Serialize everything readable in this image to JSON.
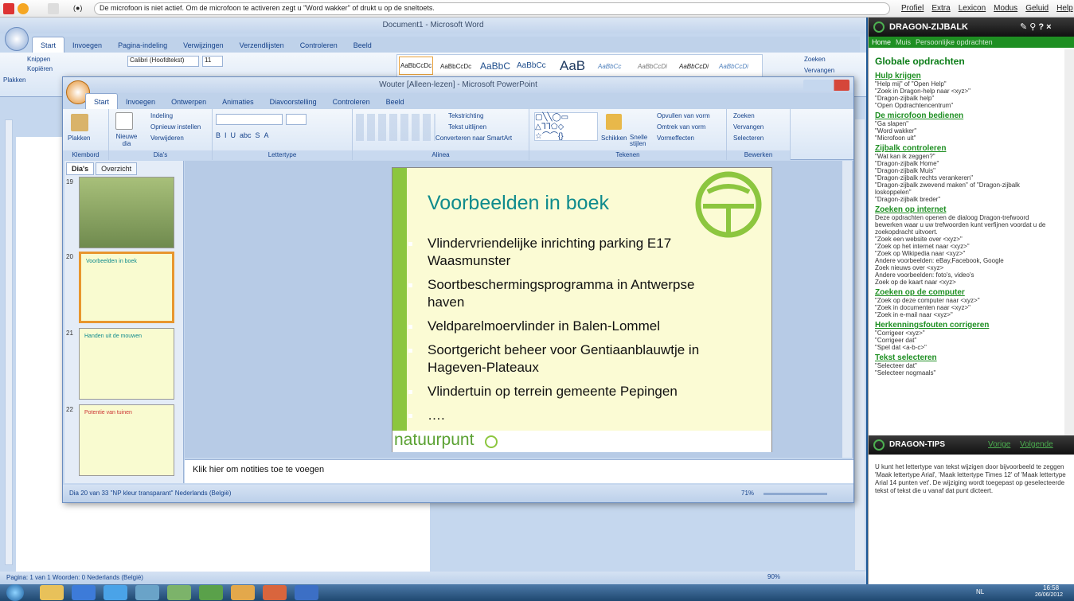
{
  "dragonbar": {
    "message": "De microfoon is niet actief. Om de microfoon te activeren zegt u \"Word wakker\" of drukt u op de sneltoets.",
    "menu": [
      "Profiel",
      "Extra",
      "Lexicon",
      "Modus",
      "Geluid",
      "Help"
    ]
  },
  "word": {
    "title": "Document1 - Microsoft Word",
    "tabs": [
      "Start",
      "Invoegen",
      "Pagina-indeling",
      "Verwijzingen",
      "Verzendlijsten",
      "Controleren",
      "Beeld"
    ],
    "font_name": "Calibri (Hoofdtekst)",
    "font_size": "11",
    "styles": [
      "AaBbCcDc",
      "AaBbCcDc",
      "AaBbC",
      "AaBbCc",
      "AaB",
      "AaBbCc",
      "AaBbCcDi",
      "AaBbCcDi",
      "AaBbCcDi"
    ],
    "clipboard": [
      "Knippen",
      "Kopiëren",
      "Plakken"
    ],
    "find": "Zoeken",
    "replace": "Vervangen",
    "status": "Pagina: 1 van 1   Woorden: 0   Nederlands (België)",
    "zoom": "90%"
  },
  "ppt": {
    "title": "Wouter [Alleen-lezen] - Microsoft PowerPoint",
    "tabs": [
      "Start",
      "Invoegen",
      "Ontwerpen",
      "Animaties",
      "Diavoorstelling",
      "Controleren",
      "Beeld"
    ],
    "ribbon": {
      "plakken": "Plakken",
      "klembord": "Klembord",
      "nieuwe_dia": "Nieuwe dia",
      "indeling": "Indeling",
      "opnieuw": "Opnieuw instellen",
      "verwijderen": "Verwijderen",
      "dias": "Dia's",
      "lettertype": "Lettertype",
      "alinea": "Alinea",
      "tekstrichting": "Tekstrichting",
      "tekst_uitlijnen": "Tekst uitlijnen",
      "smartart": "Converteren naar SmartArt",
      "tekenen": "Tekenen",
      "schikken": "Schikken",
      "snelle_stijlen": "Snelle stijlen",
      "opvullen": "Opvullen van vorm",
      "omtrek": "Omtrek van vorm",
      "vormeffecten": "Vormeffecten",
      "zoeken": "Zoeken",
      "vervangen": "Vervangen",
      "selecteren": "Selecteren",
      "bewerken": "Bewerken"
    },
    "panel_tabs": [
      "Dia's",
      "Overzicht"
    ],
    "thumbs": [
      {
        "num": "19",
        "title": ""
      },
      {
        "num": "20",
        "title": "Voorbeelden in boek"
      },
      {
        "num": "21",
        "title": "Handen uit de mouwen"
      },
      {
        "num": "22",
        "title": "Potentie van tuinen"
      }
    ],
    "slide": {
      "title": "Voorbeelden in boek",
      "bullets": [
        "Vlindervriendelijke inrichting parking E17 Waasmunster",
        "Soortbeschermingsprogramma in Antwerpse haven",
        "Veldparelmoervlinder in Balen-Lommel",
        "Soortgericht beheer voor Gentiaanblauwtje in Hageven-Plateaux",
        "Vlindertuin op terrein gemeente Pepingen",
        "…."
      ],
      "logo": "natuurpunt"
    },
    "notes": "Klik hier om notities toe te voegen",
    "status": "Dia 20 van 33   \"NP kleur transparant\"   Nederlands (België)",
    "zoom": "71%"
  },
  "sidebar": {
    "title": "Dragon-Zijbalk",
    "nav": [
      "Home",
      "Muis",
      "Persoonlijke opdrachten"
    ],
    "heading": "Globale opdrachten",
    "sections": [
      {
        "title": "Hulp krijgen",
        "items": [
          "\"Help mij\" of \"Open Help\"",
          "\"Zoek in Dragon-help naar <xyz>\"",
          "\"Dragon-zijbalk help\"",
          "\"Open Opdrachtencentrum\""
        ]
      },
      {
        "title": "De microfoon bedienen",
        "items": [
          "\"Ga slapen\"",
          "\"Word wakker\"",
          "\"Microfoon uit\""
        ]
      },
      {
        "title": "Zijbalk controleren",
        "items": [
          "\"Wat kan ik zeggen?\"",
          "\"Dragon-zijbalk Home\"",
          "\"Dragon-zijbalk Muis\"",
          "\"Dragon-zijbalk rechts verankeren\"",
          "\"Dragon-zijbalk zwevend maken\" of \"Dragon-zijbalk loskoppelen\"",
          "\"Dragon-zijbalk breder\""
        ]
      },
      {
        "title": "Zoeken op internet",
        "items": [
          "Deze opdrachten openen de dialoog Dragon-trefwoord bewerken waar u uw trefwoorden kunt verfijnen voordat u de zoekopdracht uitvoert.",
          "\"Zoek een website over <xyz>\"",
          "\"Zoek op het internet naar <xyz>\"",
          "\"Zoek op Wikipedia naar <xyz>\"",
          "Andere voorbeelden: eBay,Facebook, Google",
          "Zoek nieuws over <xyz>",
          "Andere voorbeelden: foto's, video's",
          "Zoek op de kaart naar <xyz>"
        ]
      },
      {
        "title": "Zoeken op de computer",
        "items": [
          "\"Zoek op deze computer naar <xyz>\"",
          "\"Zoek in documenten naar <xyz>\"",
          "\"Zoek in e-mail naar <xyz>\""
        ]
      },
      {
        "title": "Herkenningsfouten corrigeren",
        "items": [
          "\"Corrigeer <xyz>\"",
          "\"Corrigeer dat\"",
          "\"Spel dat <a-b-c>\""
        ]
      },
      {
        "title": "Tekst selecteren",
        "items": [
          "\"Selecteer dat\"",
          "\"Selecteer nogmaals\""
        ]
      }
    ],
    "tips_title": "Dragon-Tips",
    "tips_prev": "Vorige",
    "tips_next": "Volgende",
    "tip": "U kunt het lettertype van tekst wijzigen door bijvoorbeeld te zeggen 'Maak lettertype Arial', 'Maak lettertype Times 12' of 'Maak lettertype Arial 14 punten vet'. De wijziging wordt toegepast op geselecteerde tekst of tekst die u vanaf dat punt dicteert."
  },
  "taskbar": {
    "lang": "NL",
    "time": "16:58",
    "date": "26/06/2012"
  },
  "colors": {
    "accent": "#1e8f22",
    "slide_title": "#0f8b8d",
    "office_blue": "#15428b"
  }
}
